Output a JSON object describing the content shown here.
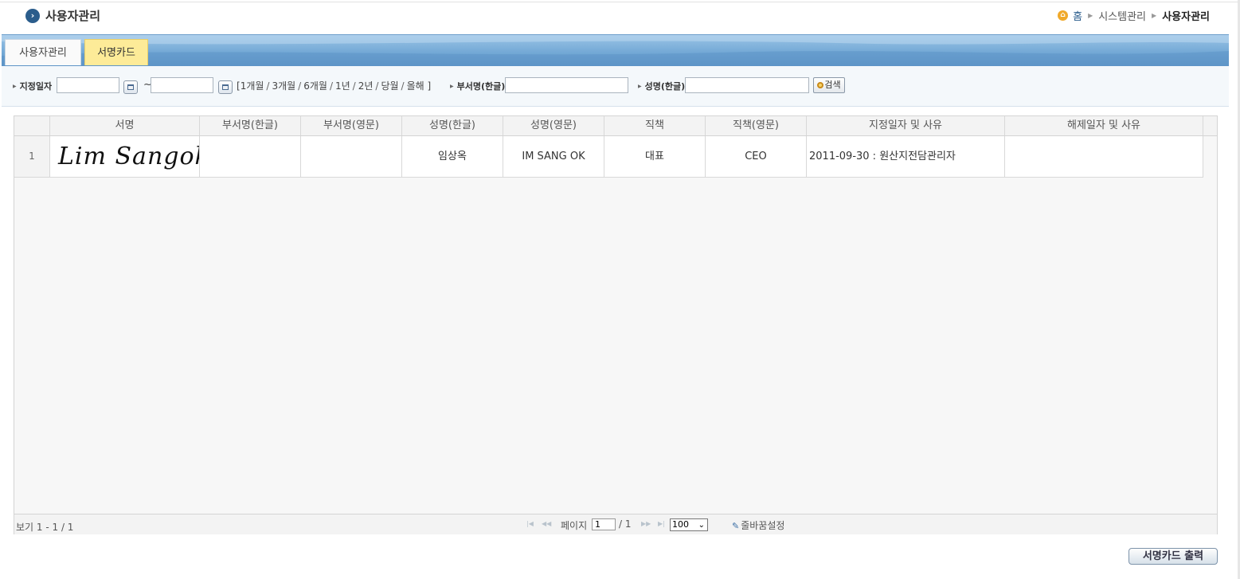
{
  "header": {
    "title": "사용자관리",
    "breadcrumb": {
      "home": "홈",
      "level1": "시스템관리",
      "current": "사용자관리"
    }
  },
  "tabs": [
    {
      "label": "사용자관리",
      "active": false
    },
    {
      "label": "서명카드",
      "active": true
    }
  ],
  "search": {
    "date_label": "지정일자",
    "date_from": "",
    "date_to": "",
    "tilde": "~",
    "period_open": "[",
    "period_close": "]",
    "periods": [
      "1개월",
      "3개월",
      "6개월",
      "1년",
      "2년",
      "당월",
      "올해"
    ],
    "dept_label": "부서명(한글)",
    "dept_value": "",
    "name_label": "성명(한글)",
    "name_value": "",
    "search_button": "검색"
  },
  "grid": {
    "columns": [
      "서명",
      "부서명(한글)",
      "부서명(영문)",
      "성명(한글)",
      "성명(영문)",
      "직책",
      "직책(영문)",
      "지정일자 및 사유",
      "해제일자 및 사유"
    ],
    "rows": [
      {
        "rownum": "1",
        "signature": "Lim Sangok",
        "dept_kr": "",
        "dept_en": "",
        "name_kr": "임상옥",
        "name_en": "IM SANG OK",
        "position": "대표",
        "position_en": "CEO",
        "assigned": "2011-09-30 : 원산지전담관리자",
        "released": ""
      }
    ]
  },
  "pager": {
    "view_info": "보기 1 - 1 / 1",
    "page_label": "페이지",
    "page_value": "1",
    "page_total": "/ 1",
    "page_size": "100",
    "column_setting": "줄바꿈설정"
  },
  "print_button": "서명카드 출력",
  "colors": {
    "tab_active": "#fdeb98",
    "tab_bar": "#74a9d6",
    "accent": "#2b5d8c"
  }
}
